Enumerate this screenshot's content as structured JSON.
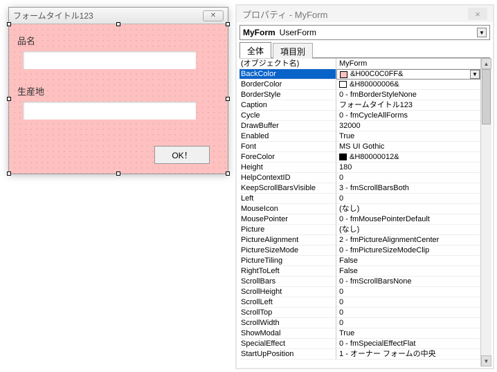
{
  "form": {
    "title": "フォームタイトル123",
    "close_glyph": "✕",
    "label1": "品名",
    "label2": "生産地",
    "ok_label": "OK！"
  },
  "props": {
    "panel_title": "プロパティ - MyForm",
    "close_glyph": "×",
    "object_name": "MyForm",
    "object_type": "UserForm",
    "tab_all": "全体",
    "tab_category": "項目別",
    "selected": "BackColor",
    "rows": [
      {
        "name": "(オブジェクト名)",
        "value": "MyForm"
      },
      {
        "name": "BackColor",
        "value": "&H00C0C0FF&",
        "swatch": "#FFC0C0",
        "dropdown": true
      },
      {
        "name": "BorderColor",
        "value": "&H80000006&",
        "swatch": "#ffffff"
      },
      {
        "name": "BorderStyle",
        "value": "0 - fmBorderStyleNone"
      },
      {
        "name": "Caption",
        "value": "フォームタイトル123"
      },
      {
        "name": "Cycle",
        "value": "0 - fmCycleAllForms"
      },
      {
        "name": "DrawBuffer",
        "value": "32000"
      },
      {
        "name": "Enabled",
        "value": "True"
      },
      {
        "name": "Font",
        "value": "MS UI Gothic"
      },
      {
        "name": "ForeColor",
        "value": "&H80000012&",
        "swatch": "#000000"
      },
      {
        "name": "Height",
        "value": "180"
      },
      {
        "name": "HelpContextID",
        "value": "0"
      },
      {
        "name": "KeepScrollBarsVisible",
        "value": "3 - fmScrollBarsBoth"
      },
      {
        "name": "Left",
        "value": "0"
      },
      {
        "name": "MouseIcon",
        "value": "(なし)"
      },
      {
        "name": "MousePointer",
        "value": "0 - fmMousePointerDefault"
      },
      {
        "name": "Picture",
        "value": "(なし)"
      },
      {
        "name": "PictureAlignment",
        "value": "2 - fmPictureAlignmentCenter"
      },
      {
        "name": "PictureSizeMode",
        "value": "0 - fmPictureSizeModeClip"
      },
      {
        "name": "PictureTiling",
        "value": "False"
      },
      {
        "name": "RightToLeft",
        "value": "False"
      },
      {
        "name": "ScrollBars",
        "value": "0 - fmScrollBarsNone"
      },
      {
        "name": "ScrollHeight",
        "value": "0"
      },
      {
        "name": "ScrollLeft",
        "value": "0"
      },
      {
        "name": "ScrollTop",
        "value": "0"
      },
      {
        "name": "ScrollWidth",
        "value": "0"
      },
      {
        "name": "ShowModal",
        "value": "True"
      },
      {
        "name": "SpecialEffect",
        "value": "0 - fmSpecialEffectFlat"
      },
      {
        "name": "StartUpPosition",
        "value": "1 - オーナー フォームの中央"
      }
    ]
  }
}
